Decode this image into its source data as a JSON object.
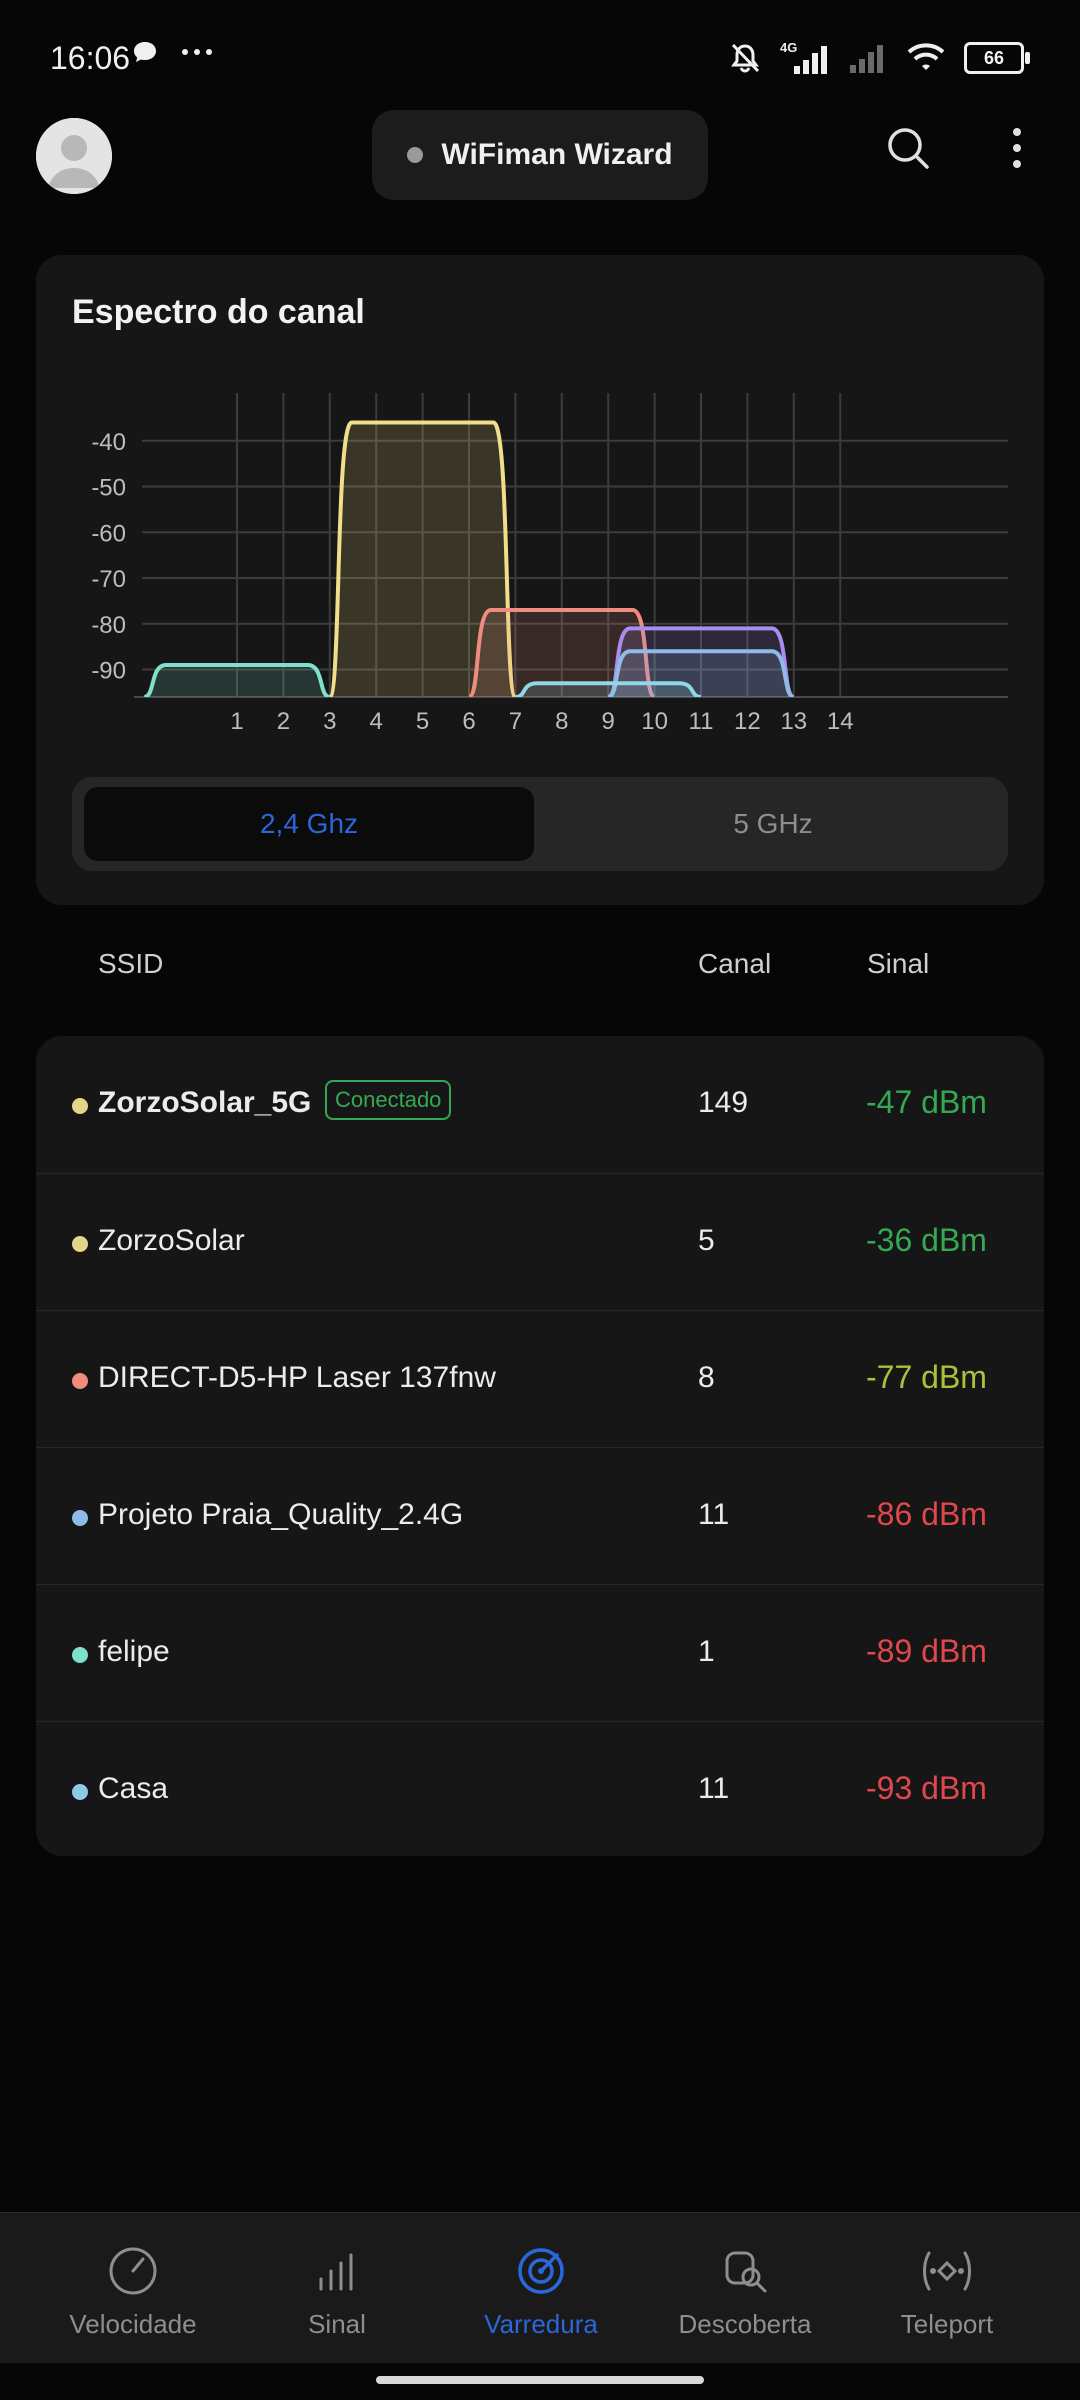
{
  "status_bar": {
    "time": "16:06",
    "battery": "66",
    "network_badge": "4G",
    "left_icons": [
      "chat-bubble-icon",
      "more-dots-icon"
    ],
    "right_icons": [
      "mute-bell-icon",
      "signal-4g-icon",
      "signal-empty-icon",
      "wifi-icon",
      "battery-icon"
    ]
  },
  "header": {
    "title": "WiFiman Wizard",
    "icons": [
      "avatar",
      "search-icon",
      "kebab-menu-icon"
    ]
  },
  "spectrum": {
    "title": "Espectro do canal",
    "band_options": [
      "2,4 Ghz",
      "5 GHz"
    ],
    "selected_band": "2,4 Ghz",
    "y_ticks": [
      "-40",
      "-50",
      "-60",
      "-70",
      "-80",
      "-90"
    ],
    "x_ticks": [
      "1",
      "2",
      "3",
      "4",
      "5",
      "6",
      "7",
      "8",
      "9",
      "10",
      "11",
      "12",
      "13",
      "14"
    ]
  },
  "chart_data": {
    "type": "area",
    "title": "Espectro do canal",
    "xlabel": "",
    "ylabel": "",
    "x_range": [
      1,
      14
    ],
    "ylim": [
      -96,
      -30
    ],
    "grid": true,
    "series": [
      {
        "channel": 1,
        "signal_dbm": -89,
        "channel_span": [
          -1,
          3
        ],
        "color": "#7fe0cc"
      },
      {
        "channel": 5,
        "signal_dbm": -36,
        "channel_span": [
          3,
          7
        ],
        "color": "#f0de8a"
      },
      {
        "channel": 8,
        "signal_dbm": -77,
        "channel_span": [
          6,
          10
        ],
        "color": "#ef8c80"
      },
      {
        "channel": 11,
        "signal_dbm": -81,
        "channel_span": [
          9,
          13
        ],
        "color": "#a98cf0"
      },
      {
        "channel": 11,
        "signal_dbm": -86,
        "channel_span": [
          9,
          13
        ],
        "color": "#8fbbe8"
      },
      {
        "channel": 9,
        "signal_dbm": -93,
        "channel_span": [
          7,
          11
        ],
        "color": "#8fd8e8"
      }
    ]
  },
  "list": {
    "headers": {
      "ssid": "SSID",
      "channel": "Canal",
      "signal": "Sinal"
    },
    "connected_label": "Conectado",
    "rows": [
      {
        "ssid": "ZorzoSolar_5G",
        "channel": "149",
        "signal": "-47 dBm",
        "dot_color": "#e6d38a",
        "signal_color": "#34a853",
        "connected": true
      },
      {
        "ssid": "ZorzoSolar",
        "channel": "5",
        "signal": "-36 dBm",
        "dot_color": "#e6d38a",
        "signal_color": "#34a853",
        "connected": false
      },
      {
        "ssid": "DIRECT-D5-HP Laser 137fnw",
        "channel": "8",
        "signal": "-77 dBm",
        "dot_color": "#ef8c80",
        "signal_color": "#a8c33a",
        "connected": false
      },
      {
        "ssid": "Projeto Praia_Quality_2.4G",
        "channel": "11",
        "signal": "-86 dBm",
        "dot_color": "#8fbbe8",
        "signal_color": "#e0474c",
        "connected": false
      },
      {
        "ssid": "felipe",
        "channel": "1",
        "signal": "-89 dBm",
        "dot_color": "#7fe0cc",
        "signal_color": "#e0474c",
        "connected": false
      },
      {
        "ssid": "Casa",
        "channel": "11",
        "signal": "-93 dBm",
        "dot_color": "#8fc8e8",
        "signal_color": "#e0474c",
        "connected": false
      }
    ]
  },
  "bottom_nav": {
    "active": "Varredura",
    "accent_color": "#2a67d8",
    "items": [
      {
        "label": "Velocidade",
        "icon": "speedometer-icon"
      },
      {
        "label": "Sinal",
        "icon": "signal-bars-icon"
      },
      {
        "label": "Varredura",
        "icon": "radar-scan-icon"
      },
      {
        "label": "Descoberta",
        "icon": "device-search-icon"
      },
      {
        "label": "Teleport",
        "icon": "teleport-icon"
      }
    ]
  }
}
